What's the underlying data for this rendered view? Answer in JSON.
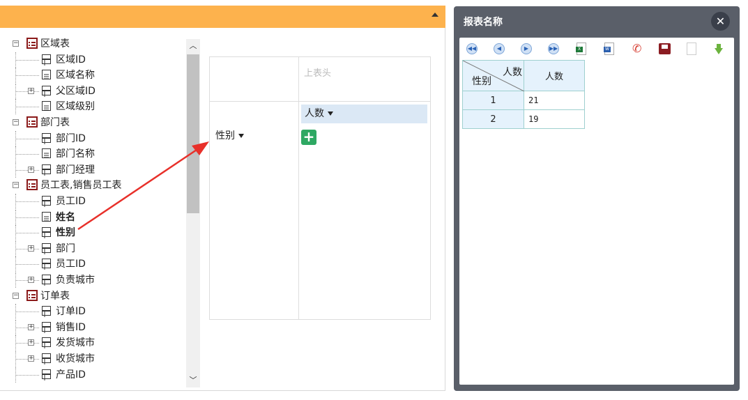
{
  "tree": {
    "nodes": [
      {
        "label": "区域表",
        "type": "table",
        "expander": "minus",
        "bold": false
      },
      {
        "label": "区域ID",
        "type": "field",
        "expander": null,
        "bold": false
      },
      {
        "label": "区域名称",
        "type": "text",
        "expander": null,
        "bold": false
      },
      {
        "label": "父区域ID",
        "type": "field",
        "expander": "plus",
        "bold": false
      },
      {
        "label": "区域级别",
        "type": "text",
        "expander": null,
        "bold": false
      },
      {
        "label": "部门表",
        "type": "table",
        "expander": "minus",
        "bold": false
      },
      {
        "label": "部门ID",
        "type": "field",
        "expander": null,
        "bold": false
      },
      {
        "label": "部门名称",
        "type": "text",
        "expander": null,
        "bold": false
      },
      {
        "label": "部门经理",
        "type": "field",
        "expander": "plus",
        "bold": false
      },
      {
        "label": "员工表,销售员工表",
        "type": "table",
        "expander": "minus",
        "bold": false
      },
      {
        "label": "员工ID",
        "type": "field",
        "expander": null,
        "bold": false
      },
      {
        "label": "姓名",
        "type": "text",
        "expander": null,
        "bold": true
      },
      {
        "label": "性别",
        "type": "field",
        "expander": null,
        "bold": true
      },
      {
        "label": "部门",
        "type": "field",
        "expander": "plus",
        "bold": false
      },
      {
        "label": "员工ID",
        "type": "field",
        "expander": null,
        "bold": false
      },
      {
        "label": "负责城市",
        "type": "field",
        "expander": "plus",
        "bold": false
      },
      {
        "label": "订单表",
        "type": "table",
        "expander": "minus",
        "bold": false
      },
      {
        "label": "订单ID",
        "type": "field",
        "expander": null,
        "bold": false
      },
      {
        "label": "销售ID",
        "type": "field",
        "expander": "plus",
        "bold": false
      },
      {
        "label": "发货城市",
        "type": "field",
        "expander": "plus",
        "bold": false
      },
      {
        "label": "收货城市",
        "type": "field",
        "expander": "plus",
        "bold": false
      },
      {
        "label": "产品ID",
        "type": "field",
        "expander": null,
        "bold": false
      }
    ]
  },
  "pivot": {
    "column_header_placeholder": "上表头",
    "row_field": "性别",
    "measure": "人数",
    "add_label": "+"
  },
  "dialog": {
    "title": "报表名称",
    "close_label": "✕",
    "toolbar": [
      "first-page-icon",
      "prev-page-icon",
      "next-page-icon",
      "last-page-icon",
      "excel-export-icon",
      "word-export-icon",
      "pdf-export-icon",
      "print-icon",
      "text-export-icon",
      "download-icon"
    ],
    "table": {
      "corner_top": "人数",
      "corner_bottom": "性别",
      "column_header": "人数",
      "rows": [
        {
          "key": "1",
          "value": "21"
        },
        {
          "key": "2",
          "value": "19"
        }
      ]
    }
  },
  "colors": {
    "header_bar": "#fdb24d",
    "dialog_frame": "#5a5f69",
    "measure_chip": "#dbe8f5",
    "add_button": "#2ea863",
    "arrow": "#e8302a",
    "table_border": "#9ed0cf",
    "table_header": "#e5f2fc"
  }
}
